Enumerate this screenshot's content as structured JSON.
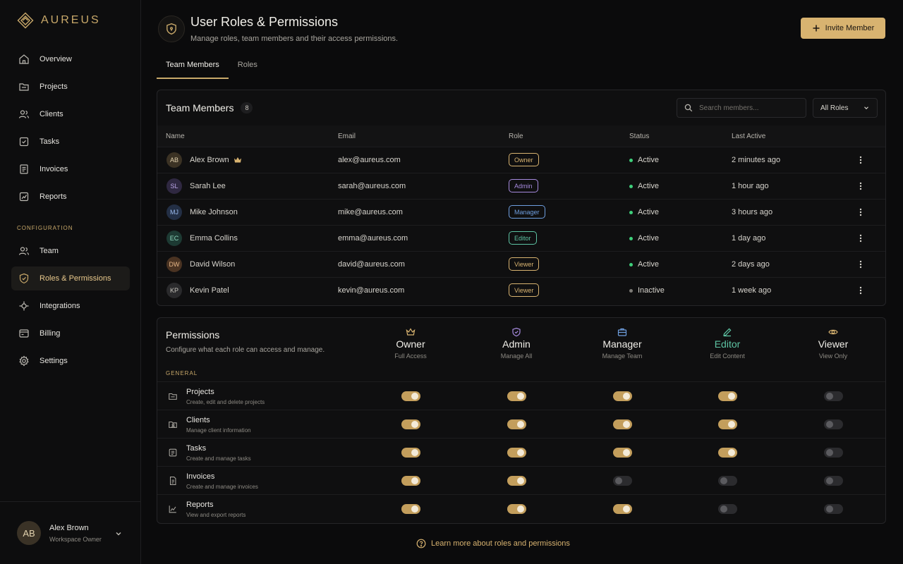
{
  "brand": {
    "name": "AUREUS"
  },
  "sidebar": {
    "items": [
      {
        "label": "Overview"
      },
      {
        "label": "Projects"
      },
      {
        "label": "Clients"
      },
      {
        "label": "Tasks"
      },
      {
        "label": "Invoices"
      },
      {
        "label": "Reports"
      }
    ],
    "section_label": "CONFIGURATION",
    "config_items": [
      {
        "label": "Team"
      },
      {
        "label": "Roles & Permissions",
        "active": true
      },
      {
        "label": "Integrations"
      },
      {
        "label": "Billing"
      },
      {
        "label": "Settings"
      }
    ],
    "user": {
      "initials": "AB",
      "name": "Alex Brown",
      "role": "Workspace Owner"
    }
  },
  "header": {
    "title": "User Roles & Permissions",
    "subtitle": "Manage roles, team members and their access permissions.",
    "invite_label": "Invite Member"
  },
  "tabs": [
    {
      "label": "Team Members",
      "active": true
    },
    {
      "label": "Roles"
    }
  ],
  "members": {
    "title": "Team Members",
    "count": "8",
    "search_placeholder": "Search members...",
    "filter_value": "All Roles",
    "columns": [
      "Name",
      "Email",
      "Role",
      "Status",
      "Last Active"
    ],
    "rows": [
      {
        "initials": "AB",
        "name": "Alex Brown",
        "email": "alex@aureus.com",
        "role": "Owner",
        "status": "Active",
        "last": "2 minutes ago",
        "crown": true
      },
      {
        "initials": "SL",
        "name": "Sarah Lee",
        "email": "sarah@aureus.com",
        "role": "Admin",
        "status": "Active",
        "last": "1 hour ago"
      },
      {
        "initials": "MJ",
        "name": "Mike Johnson",
        "email": "mike@aureus.com",
        "role": "Manager",
        "status": "Active",
        "last": "3 hours ago"
      },
      {
        "initials": "EC",
        "name": "Emma Collins",
        "email": "emma@aureus.com",
        "role": "Editor",
        "status": "Active",
        "last": "1 day ago"
      },
      {
        "initials": "DW",
        "name": "David Wilson",
        "email": "david@aureus.com",
        "role": "Viewer",
        "status": "Active",
        "last": "2 days ago"
      },
      {
        "initials": "KP",
        "name": "Kevin Patel",
        "email": "kevin@aureus.com",
        "role": "Viewer",
        "status": "Inactive",
        "last": "1 week ago"
      }
    ]
  },
  "permissions": {
    "title": "Permissions",
    "subtitle": "Configure what each role can access and manage.",
    "group_label": "GENERAL",
    "roles": [
      {
        "name": "Owner",
        "desc": "Full Access",
        "icon": "crown-icon"
      },
      {
        "name": "Admin",
        "desc": "Manage All",
        "icon": "shield-icon"
      },
      {
        "name": "Manager",
        "desc": "Manage Team",
        "icon": "briefcase-icon"
      },
      {
        "name": "Editor",
        "desc": "Edit Content",
        "icon": "pencil-icon"
      },
      {
        "name": "Viewer",
        "desc": "View Only",
        "icon": "eye-icon"
      }
    ],
    "rows": [
      {
        "name": "Projects",
        "desc": "Create, edit and delete projects",
        "values": [
          true,
          true,
          true,
          true,
          false
        ]
      },
      {
        "name": "Clients",
        "desc": "Manage client information",
        "values": [
          true,
          true,
          true,
          true,
          false
        ]
      },
      {
        "name": "Tasks",
        "desc": "Create and manage tasks",
        "values": [
          true,
          true,
          true,
          true,
          false
        ]
      },
      {
        "name": "Invoices",
        "desc": "Create and manage invoices",
        "values": [
          true,
          true,
          false,
          false,
          false
        ]
      },
      {
        "name": "Reports",
        "desc": "View and export reports",
        "values": [
          true,
          true,
          true,
          false,
          false
        ]
      }
    ]
  },
  "footer": {
    "learn_more": "Learn more about roles and permissions"
  },
  "colors": {
    "accent": "#c9a96a",
    "owner": "#d8b370",
    "admin": "#a78bdf",
    "manager": "#6f9fe0",
    "editor": "#5ec4a4",
    "viewer": "#d8b370",
    "active_dot": "#3ecf7a",
    "inactive_dot": "#7d7b76"
  }
}
